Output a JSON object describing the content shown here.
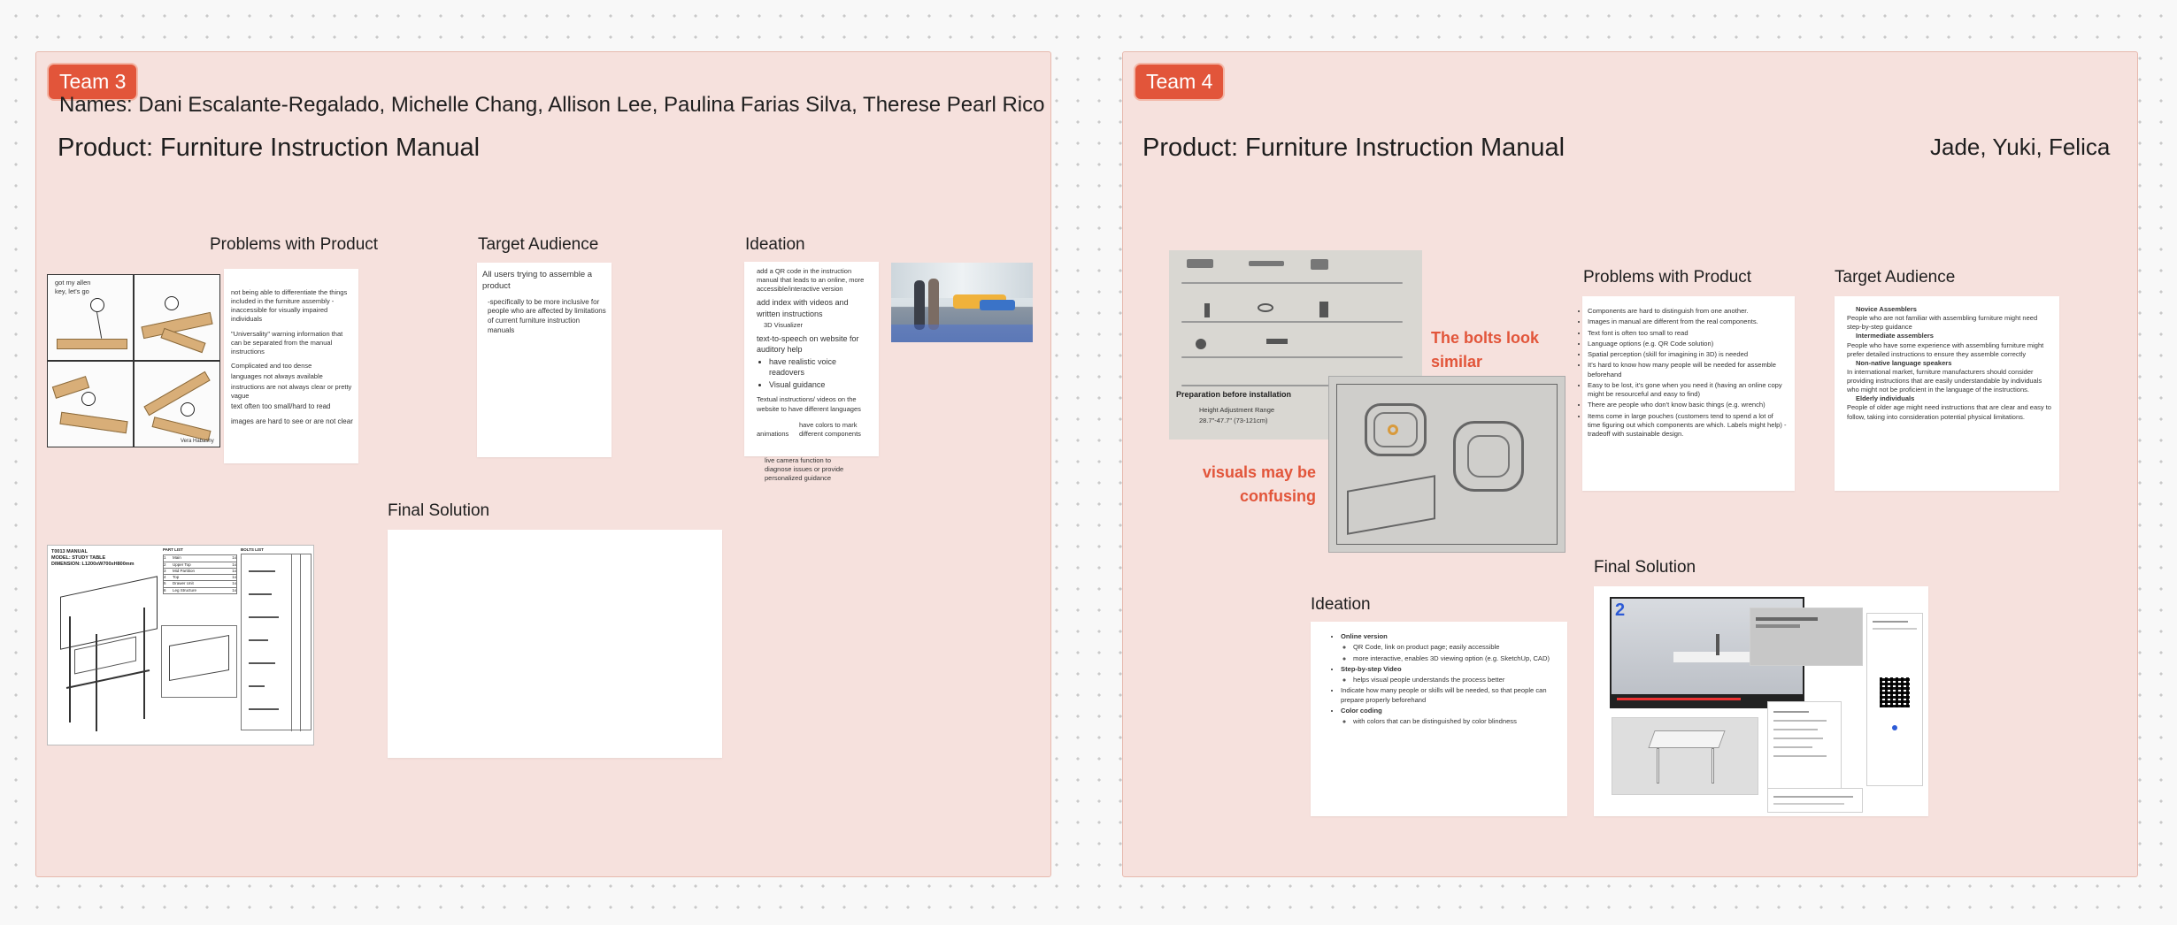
{
  "team3": {
    "tag": "Team 3",
    "names": "Names: Dani Escalante-Regalado, Michelle Chang, Allison Lee, Paulina Farias Silva, Therese Pearl Rico",
    "product": "Product: Furniture Instruction Manual",
    "problems": {
      "heading": "Problems with Product",
      "sketch_caption": "got my allen key, let's go",
      "sketch_sig": "Vera Habashy",
      "items": [
        "not being able to differentiate the things included in the furniture assembly - inaccessible for visually impaired individuals",
        "\"Universality\" warning information that can be separated from the manual instructions",
        "Complicated and too dense",
        "languages not always available",
        "instructions are not always clear or pretty vague",
        "text often too small/hard to read",
        "images are hard to see or are not clear"
      ]
    },
    "audience": {
      "heading": "Target Audience",
      "line1": "All users trying to assemble a product",
      "line2": "-specifically to be more inclusive for people who are affected by limitations of current furniture instruction manuals"
    },
    "ideation": {
      "heading": "Ideation",
      "item1": "add a QR code in the instruction manual that leads to an online, more accessible/interactive version",
      "item2": "add index with videos and written instructions",
      "item2b": "3D Visualizer",
      "item3": "text-to-speech on website for auditory help",
      "bullets": [
        "have realistic voice readovers",
        "Visual guidance"
      ],
      "item4": "Textual instructions/ videos on the website to have different languages",
      "item5": "animations",
      "item6": "have colors to mark different components",
      "item7": "live camera function to diagnose issues or provide personalized guidance"
    },
    "manual": {
      "title": "T0013 MANUAL",
      "model": "MODEL: STUDY TABLE",
      "dimension": "DIMENSION: L1200xW700xH800mm",
      "part_list": "PART LIST",
      "bolts_list": "BOLTS LIST",
      "parts": [
        {
          "no": "1",
          "name": "Main",
          "qty": "1x"
        },
        {
          "no": "2",
          "name": "Upper Top",
          "qty": "1x"
        },
        {
          "no": "3",
          "name": "Mid Partition",
          "qty": "1x"
        },
        {
          "no": "4",
          "name": "Top",
          "qty": "1x"
        },
        {
          "no": "5",
          "name": "Drawer Unit",
          "qty": "1x"
        },
        {
          "no": "6",
          "name": "Leg Structure",
          "qty": "1x"
        }
      ]
    },
    "final": {
      "heading": "Final Solution"
    }
  },
  "team4": {
    "tag": "Team 4",
    "product": "Product: Furniture Instruction Manual",
    "names": "Jade, Yuki, Felica",
    "note_bolts": "The bolts look similar",
    "note_visuals": "visuals may be confusing",
    "manual_photo_label": "Preparation before installation",
    "manual_photo_sub": "Height Adjustment Range",
    "manual_photo_sub2": "28.7\"-47.7\" (73-121cm)",
    "problems": {
      "heading": "Problems with Product",
      "items": [
        "Components are hard to distinguish from one another.",
        "Images in manual are different from the real components.",
        "Text font is often too small to read",
        "Language options (e.g. QR Code solution)",
        "Spatial perception (skill for imagining in 3D) is needed",
        "It's hard to know how many people will be needed for assemble beforehand",
        "Easy to be lost, it's gone when you need it (having an online copy might be resourceful and easy to find)",
        "There are people who don't know basic things (e.g. wrench)",
        "Items come in large pouches (customers tend to spend a lot of time figuring out which components are which. Labels might help) - tradeoff with sustainable design."
      ]
    },
    "audience": {
      "heading": "Target Audience",
      "groups": [
        {
          "title": "Novice Assemblers",
          "text": "People who are not familiar with assembling furniture might need step-by-step guidance"
        },
        {
          "title": "Intermediate assemblers",
          "text": "People who have some experience with assembling furniture might prefer detailed instructions to ensure they assemble correctly"
        },
        {
          "title": "Non-native language speakers",
          "text": "In international market, furniture manufacturers should consider providing instructions that are easily understandable by individuals who might not be proficient in the language of the instructions."
        },
        {
          "title": "Elderly individuals",
          "text": "People of older age might need instructions that are clear and easy to follow, taking into consideration potential physical limitations."
        }
      ]
    },
    "ideation": {
      "heading": "Ideation",
      "online": "Online version",
      "online_subs": [
        "QR Code, link on product page; easily accessible",
        "more interactive, enables 3D viewing option (e.g. SketchUp, CAD)"
      ],
      "video": "Step-by-step Video",
      "video_subs": [
        "helps visual people understands the process better"
      ],
      "people": "Indicate how many people or skills will be needed, so that people can prepare properly beforehand",
      "color": "Color coding",
      "color_subs": [
        "with colors that can be distinguished by color blindness"
      ]
    },
    "final": {
      "heading": "Final Solution",
      "slide_number": "2"
    }
  }
}
